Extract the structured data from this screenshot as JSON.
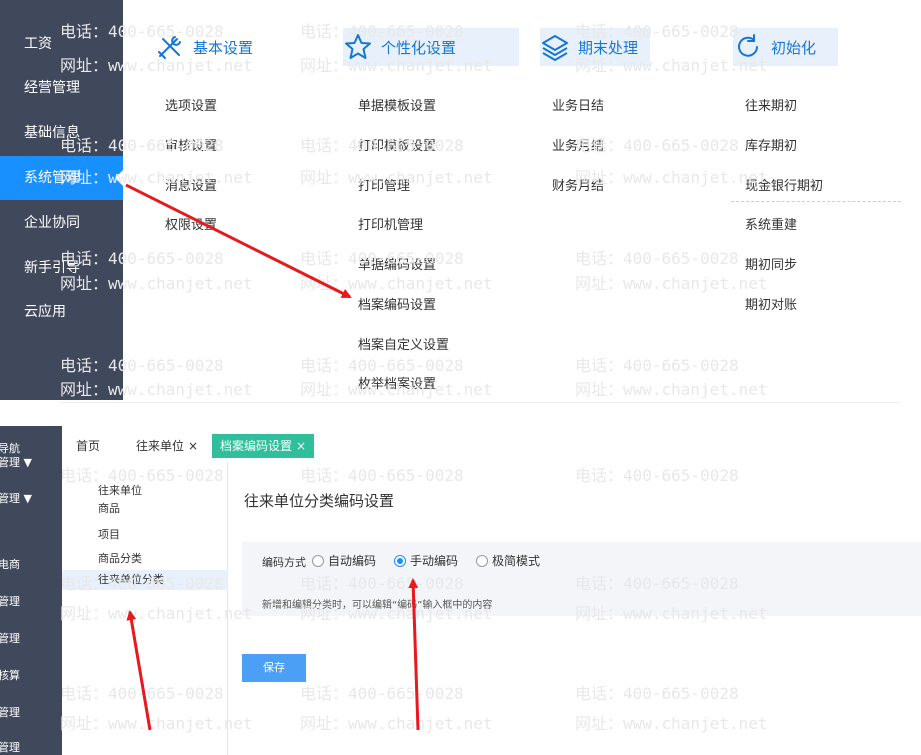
{
  "top": {
    "nav": {
      "items": [
        {
          "label": "工资"
        },
        {
          "label": "经营管理"
        },
        {
          "label": "基础信息"
        },
        {
          "label": "系统管理"
        },
        {
          "label": "企业协同"
        },
        {
          "label": "新手引导"
        },
        {
          "label": "云应用"
        }
      ],
      "active": "系统管理"
    },
    "categories": [
      {
        "icon": "tools-icon",
        "title": "基本设置",
        "items": [
          "选项设置",
          "审核设置",
          "消息设置",
          "权限设置"
        ]
      },
      {
        "icon": "star-icon",
        "title": "个性化设置",
        "items": [
          "单据模板设置",
          "打印模板设置",
          "打印管理",
          "打印机管理",
          "单据编码设置",
          "档案编码设置",
          "档案自定义设置",
          "枚举档案设置"
        ]
      },
      {
        "icon": "stack-icon",
        "title": "期末处理",
        "items": [
          "业务日结",
          "业务月结",
          "财务月结"
        ]
      },
      {
        "icon": "refresh-icon",
        "title": "初始化",
        "items": [
          "往来期初",
          "库存期初",
          "现金银行期初",
          "系统重建",
          "期初同步",
          "期初对账"
        ]
      }
    ]
  },
  "bottom": {
    "sidebar": [
      "导航",
      "管理 ▼",
      "管理 ▼",
      "电商",
      "管理",
      "管理",
      "核算",
      "管理",
      "管理"
    ],
    "tabs": {
      "home": "首页",
      "contacts": "往来单位",
      "active": "档案编码设置",
      "close": "×"
    },
    "tree": [
      "往来单位",
      "商品",
      "项目",
      "商品分类",
      "往来单位分类"
    ],
    "content": {
      "title": "往来单位分类编码设置",
      "encode_label": "编码方式",
      "options": [
        "自动编码",
        "手动编码",
        "极简模式"
      ],
      "selected": "手动编码",
      "hint": "新增和编辑分类时，可以编辑“编码”输入框中的内容",
      "save": "保存"
    }
  },
  "watermark": {
    "phone": "电话：400-665-0028",
    "site": "网址：www.chanjet.net"
  },
  "colors": {
    "sidebar_bg": "#40485b",
    "active_blue": "#1891ff",
    "tab_active": "#2fbf9b",
    "arrow_red": "#e8191c"
  }
}
